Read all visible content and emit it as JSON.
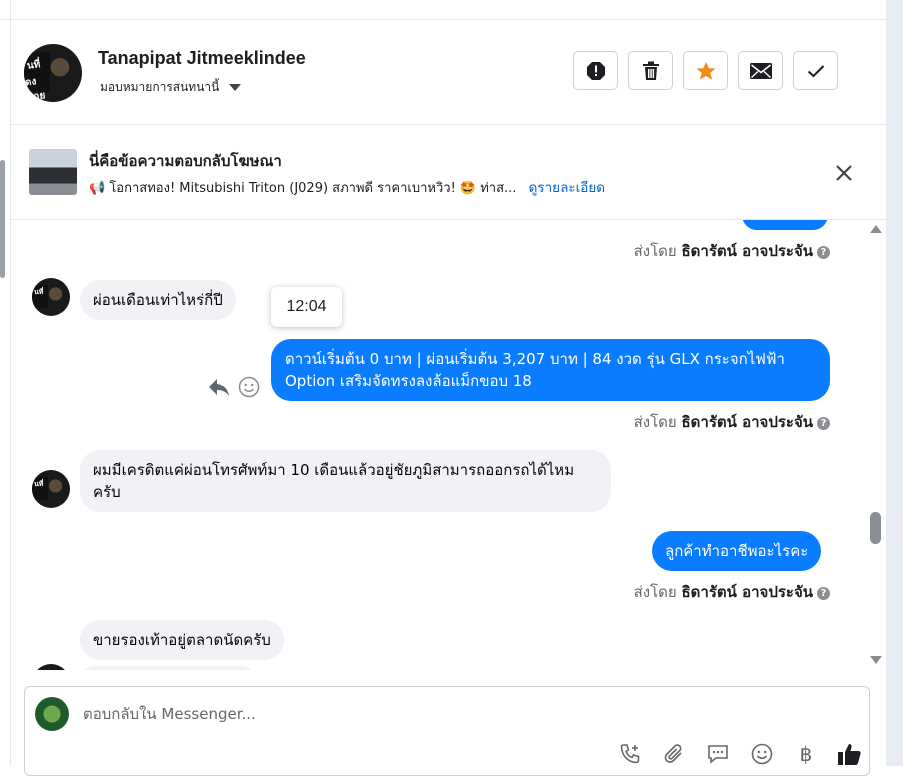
{
  "header": {
    "contact_name": "Tanapipat Jitmeeklindee",
    "assign_label": "มอบหมายการสนทนานี้",
    "actions": [
      {
        "name": "spam",
        "icon": "alert-octagon-icon"
      },
      {
        "name": "delete",
        "icon": "trash-icon"
      },
      {
        "name": "star",
        "icon": "star-icon"
      },
      {
        "name": "unread",
        "icon": "envelope-icon"
      },
      {
        "name": "done",
        "icon": "check-icon"
      }
    ]
  },
  "ad_reply": {
    "title": "นี่คือข้อความตอบกลับโฆษณา",
    "description": "📢 โอกาสทอง! Mitsubishi Triton (J029) สภาพดี ราคาเบาหวิว! 🤩 ท่าส...",
    "link_label": "ดูรายละเอียด"
  },
  "messages": {
    "sent_by_prefix": "ส่งโดย",
    "agent_name": "ธิดารัตน์ อาจประจัน",
    "m1_text": "ผ่อนเดือนเท่าไหร่กี่ปี",
    "tooltip_time": "12:04",
    "m2_text": "ดาวน์เริ่มต้น 0 บาท | ผ่อนเริ่มต้น 3,207 บาท | 84 งวด รุ่น GLX กระจกไฟฟ้า Option เสริมจัดทรงลงล้อแม็กขอบ 18",
    "m3_text": "ผมมีเครดิตแค่ผ่อนโทรศัพท์มา 10 เดือนแล้วอยู่ชัยภูมิสามารถออกรถได้ไหมครับ",
    "m4_text": "ลูกค้าทำอาชีพอะไรคะ",
    "m5_text": "ขายรองเท้าอยู่ตลาดนัดครับ"
  },
  "composer": {
    "placeholder": "ตอบกลับใน Messenger..."
  },
  "colors": {
    "outgoing_bubble": "#0a7cff",
    "incoming_bubble": "#f0f2f5",
    "link": "#0064d1",
    "star": "#f28c18"
  }
}
